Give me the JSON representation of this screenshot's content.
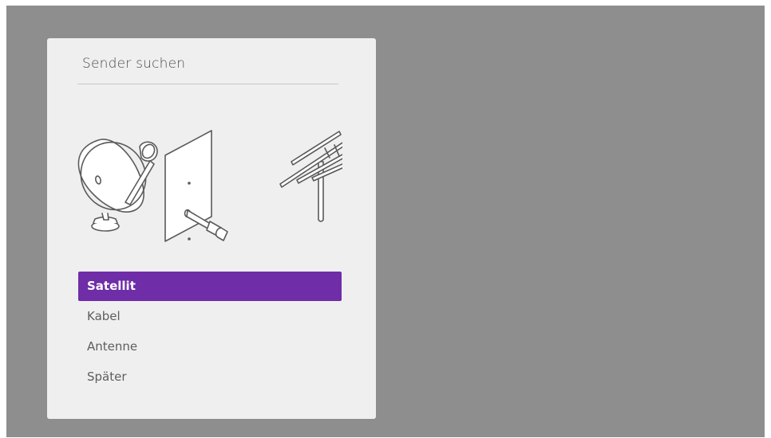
{
  "dialog": {
    "title": "Sender suchen"
  },
  "illustration": {
    "icons": [
      "satellite-dish-icon",
      "coax-wall-plate-icon",
      "tv-antenna-icon"
    ]
  },
  "menu": {
    "selected_index": 0,
    "items": [
      {
        "label": "Satellit"
      },
      {
        "label": "Kabel"
      },
      {
        "label": "Antenne"
      },
      {
        "label": "Später"
      }
    ]
  },
  "colors": {
    "background": "#8e8e8e",
    "dialog": "#efefef",
    "accent": "#6f2da8"
  }
}
